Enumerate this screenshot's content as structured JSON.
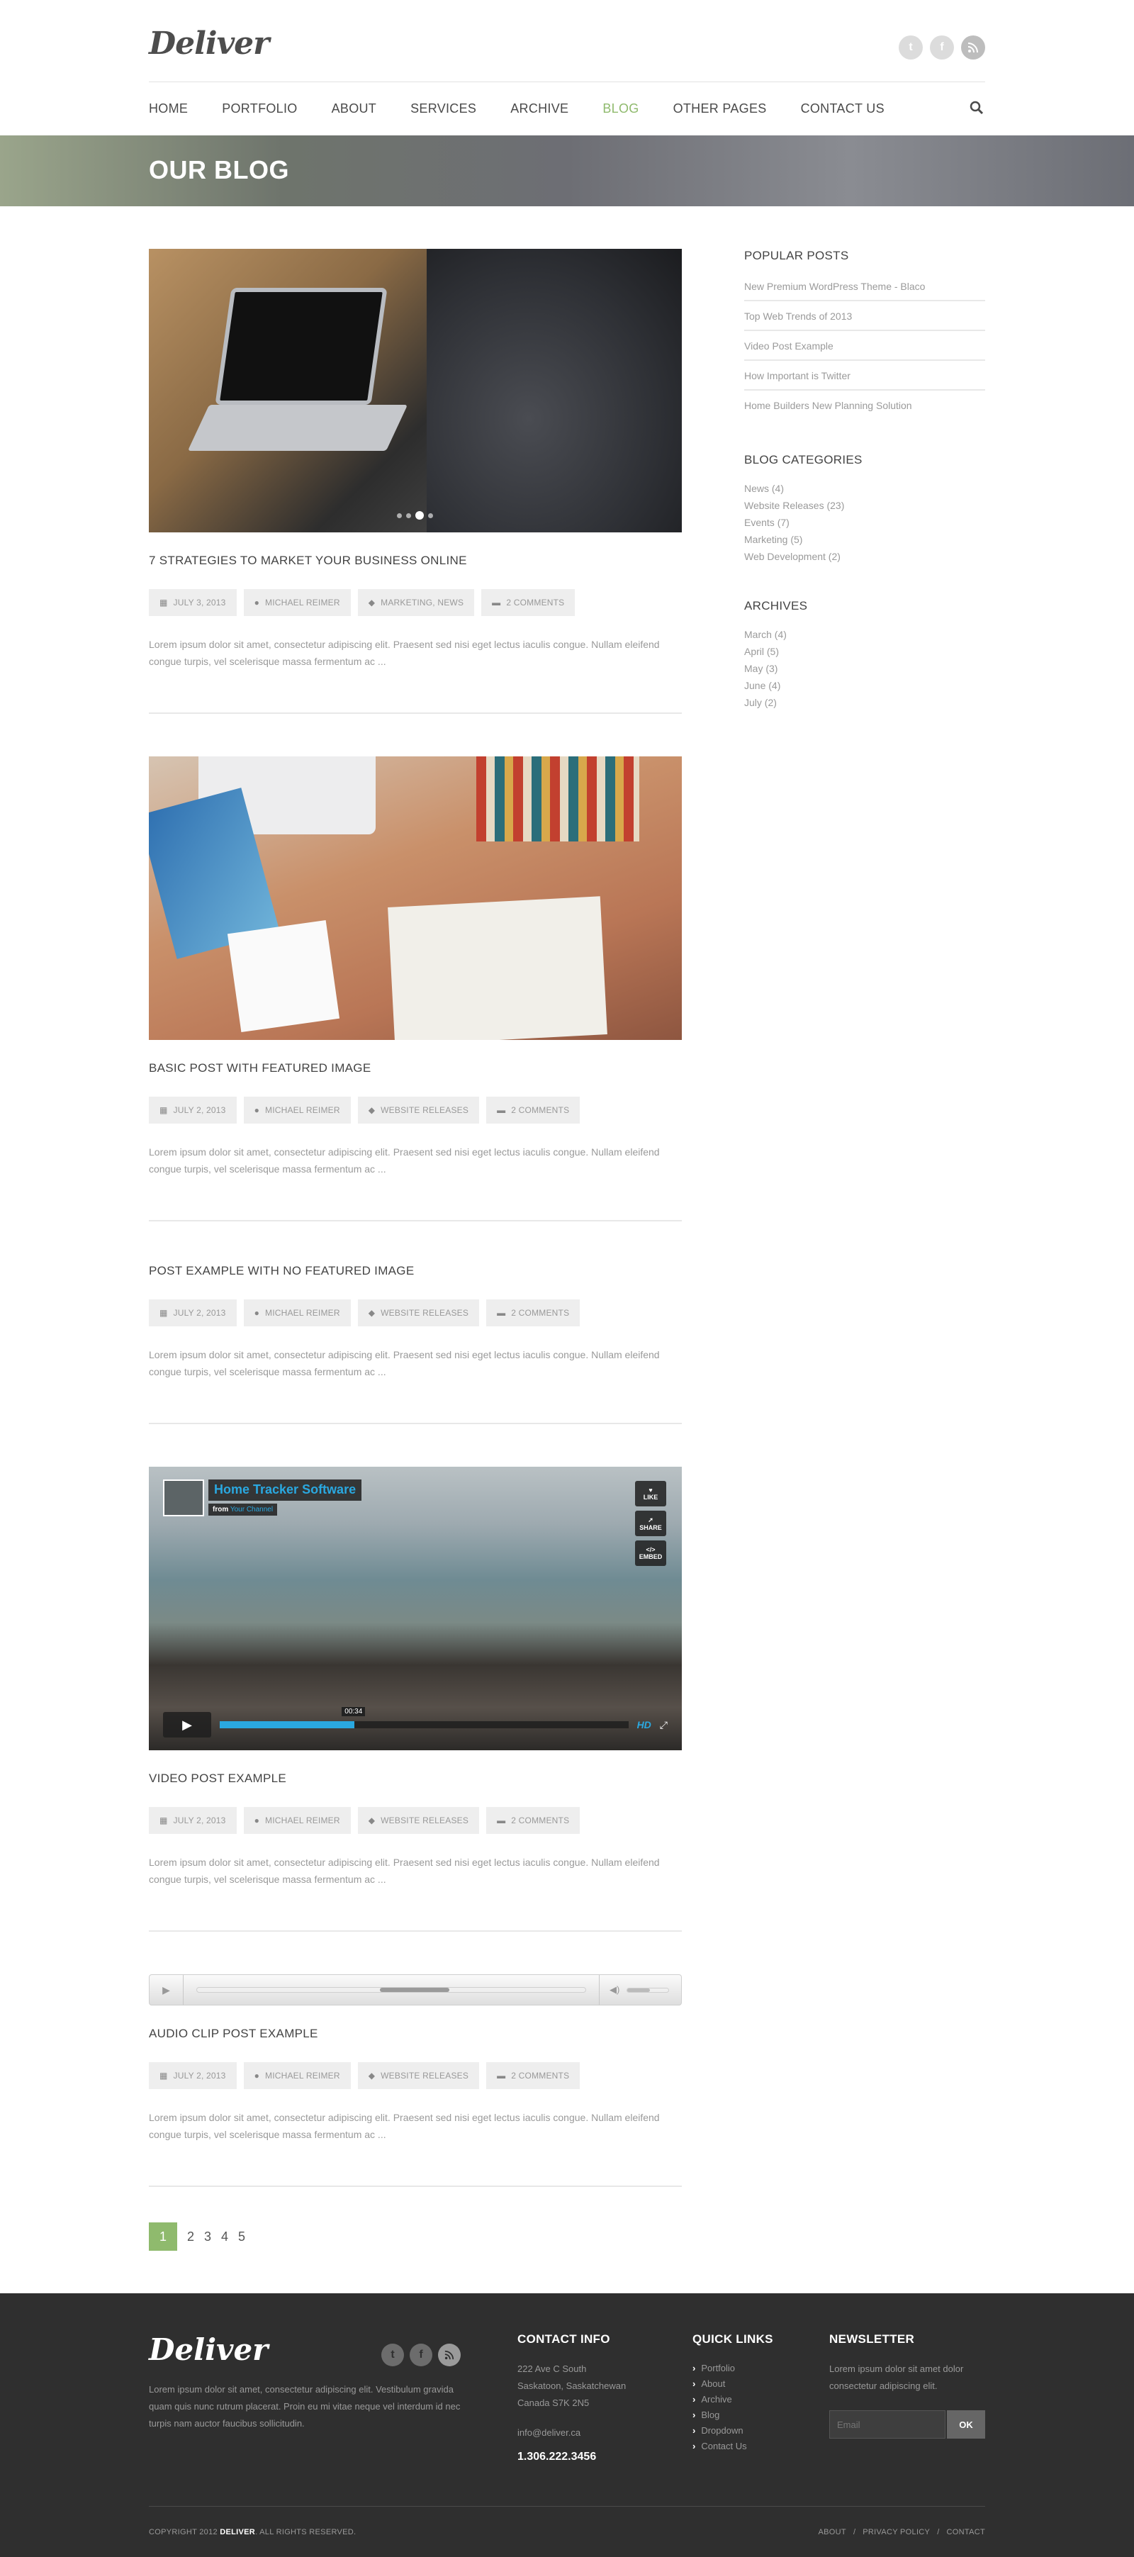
{
  "header": {
    "logo": "Deliver",
    "socials": [
      "twitter-icon",
      "facebook-icon",
      "rss-icon"
    ],
    "nav": [
      {
        "label": "HOME"
      },
      {
        "label": "PORTFOLIO"
      },
      {
        "label": "ABOUT"
      },
      {
        "label": "SERVICES"
      },
      {
        "label": "ARCHIVE"
      },
      {
        "label": "BLOG",
        "active": true
      },
      {
        "label": "OTHER PAGES"
      },
      {
        "label": "CONTACT US"
      }
    ],
    "active_color": "#8fba6d"
  },
  "banner": {
    "title": "OUR BLOG"
  },
  "posts": [
    {
      "title": "7 STRATEGIES TO MARKET YOUR BUSINESS ONLINE",
      "date": "JULY 3, 2013",
      "author": "MICHAEL REIMER",
      "category": "MARKETING, NEWS",
      "comments": "2 COMMENTS",
      "excerpt": "Lorem ipsum dolor sit amet, consectetur adipiscing elit. Praesent sed nisi eget lectus iaculis congue. Nullam eleifend congue turpis, vel scelerisque massa fermentum ac ..."
    },
    {
      "title": "BASIC POST WITH FEATURED IMAGE",
      "date": "JULY 2, 2013",
      "author": "MICHAEL REIMER",
      "category": "WEBSITE RELEASES",
      "comments": "2 COMMENTS",
      "excerpt": "Lorem ipsum dolor sit amet, consectetur adipiscing elit. Praesent sed nisi eget lectus iaculis congue. Nullam eleifend congue turpis, vel scelerisque massa fermentum ac ..."
    },
    {
      "title": "POST EXAMPLE WITH NO FEATURED IMAGE",
      "date": "JULY 2, 2013",
      "author": "MICHAEL REIMER",
      "category": "WEBSITE RELEASES",
      "comments": "2 COMMENTS",
      "excerpt": "Lorem ipsum dolor sit amet, consectetur adipiscing elit. Praesent sed nisi eget lectus iaculis congue. Nullam eleifend congue turpis, vel scelerisque massa fermentum ac ..."
    },
    {
      "title": "VIDEO POST EXAMPLE",
      "date": "JULY 2, 2013",
      "author": "MICHAEL REIMER",
      "category": "WEBSITE RELEASES",
      "comments": "2 COMMENTS",
      "excerpt": "Lorem ipsum dolor sit amet, consectetur adipiscing elit. Praesent sed nisi eget lectus iaculis congue. Nullam eleifend congue turpis, vel scelerisque massa fermentum ac ..."
    },
    {
      "title": "AUDIO CLIP POST EXAMPLE",
      "date": "JULY 2, 2013",
      "author": "MICHAEL REIMER",
      "category": "WEBSITE RELEASES",
      "comments": "2 COMMENTS",
      "excerpt": "Lorem ipsum dolor sit amet, consectetur adipiscing elit. Praesent sed nisi eget lectus iaculis congue. Nullam eleifend congue turpis, vel scelerisque massa fermentum ac ..."
    }
  ],
  "video": {
    "title": "Home Tracker Software",
    "from_prefix": "from",
    "channel": "Your Channel",
    "time": "00:34",
    "progress": 0.33,
    "buttons": [
      "LIKE",
      "SHARE",
      "EMBED"
    ],
    "hd": "HD"
  },
  "audio": {
    "progress_start": 0.47,
    "progress_end": 0.65,
    "volume": 0.55
  },
  "pagination": {
    "current": "1",
    "pages": [
      "2",
      "3",
      "4",
      "5"
    ],
    "accent": "#8fba6d"
  },
  "sidebar": {
    "popular_title": "POPULAR POSTS",
    "popular": [
      "New Premium WordPress Theme - Blaco",
      "Top Web Trends of 2013",
      "Video Post Example",
      "How Important is Twitter",
      "Home Builders New Planning Solution"
    ],
    "categories_title": "BLOG CATEGORIES",
    "categories": [
      "News (4)",
      "Website Releases (23)",
      "Events (7)",
      "Marketing (5)",
      "Web Development (2)"
    ],
    "archives_title": "ARCHIVES",
    "archives": [
      "March (4)",
      "April (5)",
      "May (3)",
      "June (4)",
      "July (2)"
    ]
  },
  "footer": {
    "logo": "Deliver",
    "about": "Lorem ipsum dolor sit amet, consectetur adipiscing elit. Vestibulum gravida quam quis nunc rutrum placerat. Proin eu mi vitae neque vel interdum id nec turpis nam auctor faucibus sollicitudin.",
    "contact_title": "CONTACT INFO",
    "address": [
      "222 Ave C South",
      "Saskatoon, Saskatchewan",
      "Canada S7K 2N5"
    ],
    "email": "info@deliver.ca",
    "phone": "1.306.222.3456",
    "links_title": "QUICK LINKS",
    "links": [
      "Portfolio",
      "About",
      "Archive",
      "Blog",
      "Dropdown",
      "Contact Us"
    ],
    "newsletter_title": "NEWSLETTER",
    "newsletter_text": "Lorem ipsum dolor sit amet dolor consectetur adipiscing elit.",
    "newsletter_placeholder": "Email",
    "newsletter_button": "OK",
    "copyright_prefix": "COPYRIGHT 2012",
    "copyright_brand": "DELIVER",
    "copyright_suffix": ". ALL RIGHTS RESERVED.",
    "bottom_links": [
      "ABOUT",
      "PRIVACY POLICY",
      "CONTACT"
    ]
  }
}
